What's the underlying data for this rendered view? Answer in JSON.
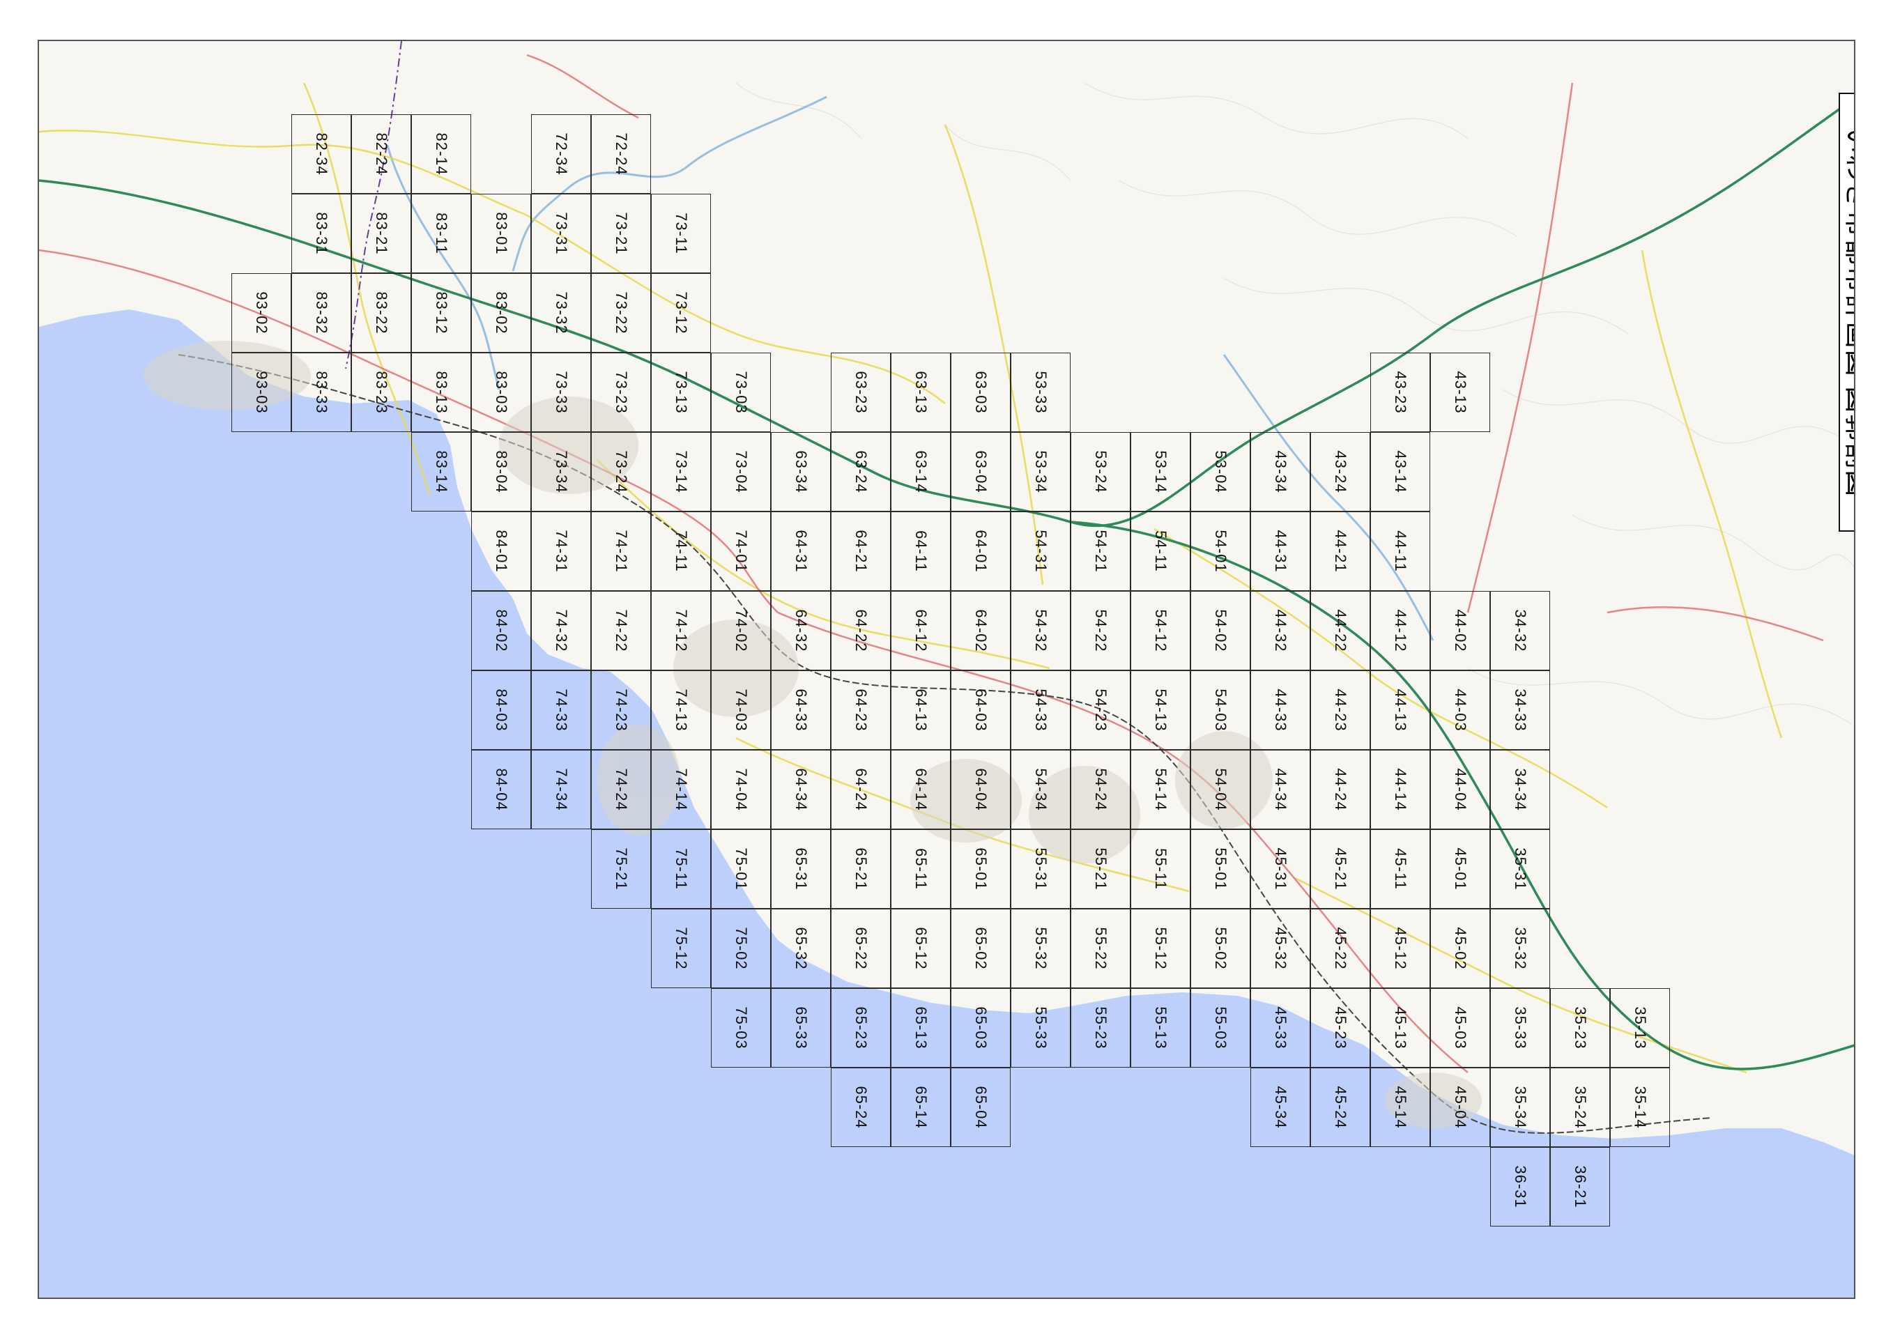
{
  "title": "いわき市都市計画図 図郭割図",
  "colors": {
    "sea": "#bcd0fb",
    "land": "#f7f6f1",
    "expressway": "#2e8b57",
    "national_road": "#e07a7a",
    "prefectural_road": "#e8d84a",
    "railway": "#555555",
    "river": "#6fa8dc",
    "boundary": "#6a3d9a"
  },
  "cells": [
    {
      "id": "82-34",
      "c": 0,
      "r": 0
    },
    {
      "id": "82-24",
      "c": 1,
      "r": 0
    },
    {
      "id": "82-14",
      "c": 2,
      "r": 0
    },
    {
      "id": "72-34",
      "c": 4,
      "r": 0
    },
    {
      "id": "72-24",
      "c": 5,
      "r": 0
    },
    {
      "id": "83-31",
      "c": 0,
      "r": 1
    },
    {
      "id": "83-21",
      "c": 1,
      "r": 1
    },
    {
      "id": "83-11",
      "c": 2,
      "r": 1
    },
    {
      "id": "83-01",
      "c": 3,
      "r": 1
    },
    {
      "id": "73-31",
      "c": 4,
      "r": 1
    },
    {
      "id": "73-21",
      "c": 5,
      "r": 1
    },
    {
      "id": "73-11",
      "c": 6,
      "r": 1
    },
    {
      "id": "93-02",
      "c": -1,
      "r": 2
    },
    {
      "id": "83-32",
      "c": 0,
      "r": 2
    },
    {
      "id": "83-22",
      "c": 1,
      "r": 2
    },
    {
      "id": "83-12",
      "c": 2,
      "r": 2
    },
    {
      "id": "83-02",
      "c": 3,
      "r": 2
    },
    {
      "id": "73-32",
      "c": 4,
      "r": 2
    },
    {
      "id": "73-22",
      "c": 5,
      "r": 2
    },
    {
      "id": "73-12",
      "c": 6,
      "r": 2
    },
    {
      "id": "93-03",
      "c": -1,
      "r": 3
    },
    {
      "id": "83-33",
      "c": 0,
      "r": 3
    },
    {
      "id": "83-23",
      "c": 1,
      "r": 3
    },
    {
      "id": "83-13",
      "c": 2,
      "r": 3
    },
    {
      "id": "83-03",
      "c": 3,
      "r": 3
    },
    {
      "id": "73-33",
      "c": 4,
      "r": 3
    },
    {
      "id": "73-23",
      "c": 5,
      "r": 3
    },
    {
      "id": "73-13",
      "c": 6,
      "r": 3
    },
    {
      "id": "73-03",
      "c": 7,
      "r": 3
    },
    {
      "id": "63-23",
      "c": 9,
      "r": 3
    },
    {
      "id": "63-13",
      "c": 10,
      "r": 3
    },
    {
      "id": "63-03",
      "c": 11,
      "r": 3
    },
    {
      "id": "53-33",
      "c": 12,
      "r": 3
    },
    {
      "id": "43-23",
      "c": 18,
      "r": 3
    },
    {
      "id": "43-13",
      "c": 19,
      "r": 3
    },
    {
      "id": "83-14",
      "c": 2,
      "r": 4
    },
    {
      "id": "83-04",
      "c": 3,
      "r": 4
    },
    {
      "id": "73-34",
      "c": 4,
      "r": 4
    },
    {
      "id": "73-24",
      "c": 5,
      "r": 4
    },
    {
      "id": "73-14",
      "c": 6,
      "r": 4
    },
    {
      "id": "73-04",
      "c": 7,
      "r": 4
    },
    {
      "id": "63-34",
      "c": 8,
      "r": 4
    },
    {
      "id": "63-24",
      "c": 9,
      "r": 4
    },
    {
      "id": "63-14",
      "c": 10,
      "r": 4
    },
    {
      "id": "63-04",
      "c": 11,
      "r": 4
    },
    {
      "id": "53-34",
      "c": 12,
      "r": 4
    },
    {
      "id": "53-24",
      "c": 13,
      "r": 4
    },
    {
      "id": "53-14",
      "c": 14,
      "r": 4
    },
    {
      "id": "53-04",
      "c": 15,
      "r": 4
    },
    {
      "id": "43-34",
      "c": 16,
      "r": 4
    },
    {
      "id": "43-24",
      "c": 17,
      "r": 4
    },
    {
      "id": "43-14",
      "c": 18,
      "r": 4
    },
    {
      "id": "84-01",
      "c": 3,
      "r": 5
    },
    {
      "id": "74-31",
      "c": 4,
      "r": 5
    },
    {
      "id": "74-21",
      "c": 5,
      "r": 5
    },
    {
      "id": "74-11",
      "c": 6,
      "r": 5
    },
    {
      "id": "74-01",
      "c": 7,
      "r": 5
    },
    {
      "id": "64-31",
      "c": 8,
      "r": 5
    },
    {
      "id": "64-21",
      "c": 9,
      "r": 5
    },
    {
      "id": "64-11",
      "c": 10,
      "r": 5
    },
    {
      "id": "64-01",
      "c": 11,
      "r": 5
    },
    {
      "id": "54-31",
      "c": 12,
      "r": 5
    },
    {
      "id": "54-21",
      "c": 13,
      "r": 5
    },
    {
      "id": "54-11",
      "c": 14,
      "r": 5
    },
    {
      "id": "54-01",
      "c": 15,
      "r": 5
    },
    {
      "id": "44-31",
      "c": 16,
      "r": 5
    },
    {
      "id": "44-21",
      "c": 17,
      "r": 5
    },
    {
      "id": "44-11",
      "c": 18,
      "r": 5
    },
    {
      "id": "84-02",
      "c": 3,
      "r": 6
    },
    {
      "id": "74-32",
      "c": 4,
      "r": 6
    },
    {
      "id": "74-22",
      "c": 5,
      "r": 6
    },
    {
      "id": "74-12",
      "c": 6,
      "r": 6
    },
    {
      "id": "74-02",
      "c": 7,
      "r": 6
    },
    {
      "id": "64-32",
      "c": 8,
      "r": 6
    },
    {
      "id": "64-22",
      "c": 9,
      "r": 6
    },
    {
      "id": "64-12",
      "c": 10,
      "r": 6
    },
    {
      "id": "64-02",
      "c": 11,
      "r": 6
    },
    {
      "id": "54-32",
      "c": 12,
      "r": 6
    },
    {
      "id": "54-22",
      "c": 13,
      "r": 6
    },
    {
      "id": "54-12",
      "c": 14,
      "r": 6
    },
    {
      "id": "54-02",
      "c": 15,
      "r": 6
    },
    {
      "id": "44-32",
      "c": 16,
      "r": 6
    },
    {
      "id": "44-22",
      "c": 17,
      "r": 6
    },
    {
      "id": "44-12",
      "c": 18,
      "r": 6
    },
    {
      "id": "44-02",
      "c": 19,
      "r": 6
    },
    {
      "id": "34-32",
      "c": 20,
      "r": 6
    },
    {
      "id": "84-03",
      "c": 3,
      "r": 7
    },
    {
      "id": "74-33",
      "c": 4,
      "r": 7
    },
    {
      "id": "74-23",
      "c": 5,
      "r": 7
    },
    {
      "id": "74-13",
      "c": 6,
      "r": 7
    },
    {
      "id": "74-03",
      "c": 7,
      "r": 7
    },
    {
      "id": "64-33",
      "c": 8,
      "r": 7
    },
    {
      "id": "64-23",
      "c": 9,
      "r": 7
    },
    {
      "id": "64-13",
      "c": 10,
      "r": 7
    },
    {
      "id": "64-03",
      "c": 11,
      "r": 7
    },
    {
      "id": "54-33",
      "c": 12,
      "r": 7
    },
    {
      "id": "54-23",
      "c": 13,
      "r": 7
    },
    {
      "id": "54-13",
      "c": 14,
      "r": 7
    },
    {
      "id": "54-03",
      "c": 15,
      "r": 7
    },
    {
      "id": "44-33",
      "c": 16,
      "r": 7
    },
    {
      "id": "44-23",
      "c": 17,
      "r": 7
    },
    {
      "id": "44-13",
      "c": 18,
      "r": 7
    },
    {
      "id": "44-03",
      "c": 19,
      "r": 7
    },
    {
      "id": "34-33",
      "c": 20,
      "r": 7
    },
    {
      "id": "84-04",
      "c": 3,
      "r": 8
    },
    {
      "id": "74-34",
      "c": 4,
      "r": 8
    },
    {
      "id": "74-24",
      "c": 5,
      "r": 8
    },
    {
      "id": "74-14",
      "c": 6,
      "r": 8
    },
    {
      "id": "74-04",
      "c": 7,
      "r": 8
    },
    {
      "id": "64-34",
      "c": 8,
      "r": 8
    },
    {
      "id": "64-24",
      "c": 9,
      "r": 8
    },
    {
      "id": "64-14",
      "c": 10,
      "r": 8
    },
    {
      "id": "64-04",
      "c": 11,
      "r": 8
    },
    {
      "id": "54-34",
      "c": 12,
      "r": 8
    },
    {
      "id": "54-24",
      "c": 13,
      "r": 8
    },
    {
      "id": "54-14",
      "c": 14,
      "r": 8
    },
    {
      "id": "54-04",
      "c": 15,
      "r": 8
    },
    {
      "id": "44-34",
      "c": 16,
      "r": 8
    },
    {
      "id": "44-24",
      "c": 17,
      "r": 8
    },
    {
      "id": "44-14",
      "c": 18,
      "r": 8
    },
    {
      "id": "44-04",
      "c": 19,
      "r": 8
    },
    {
      "id": "34-34",
      "c": 20,
      "r": 8
    },
    {
      "id": "75-21",
      "c": 5,
      "r": 9
    },
    {
      "id": "75-11",
      "c": 6,
      "r": 9
    },
    {
      "id": "75-01",
      "c": 7,
      "r": 9
    },
    {
      "id": "65-31",
      "c": 8,
      "r": 9
    },
    {
      "id": "65-21",
      "c": 9,
      "r": 9
    },
    {
      "id": "65-11",
      "c": 10,
      "r": 9
    },
    {
      "id": "65-01",
      "c": 11,
      "r": 9
    },
    {
      "id": "55-31",
      "c": 12,
      "r": 9
    },
    {
      "id": "55-21",
      "c": 13,
      "r": 9
    },
    {
      "id": "55-11",
      "c": 14,
      "r": 9
    },
    {
      "id": "55-01",
      "c": 15,
      "r": 9
    },
    {
      "id": "45-31",
      "c": 16,
      "r": 9
    },
    {
      "id": "45-21",
      "c": 17,
      "r": 9
    },
    {
      "id": "45-11",
      "c": 18,
      "r": 9
    },
    {
      "id": "45-01",
      "c": 19,
      "r": 9
    },
    {
      "id": "35-31",
      "c": 20,
      "r": 9
    },
    {
      "id": "75-12",
      "c": 6,
      "r": 10
    },
    {
      "id": "75-02",
      "c": 7,
      "r": 10
    },
    {
      "id": "65-32",
      "c": 8,
      "r": 10
    },
    {
      "id": "65-22",
      "c": 9,
      "r": 10
    },
    {
      "id": "65-12",
      "c": 10,
      "r": 10
    },
    {
      "id": "65-02",
      "c": 11,
      "r": 10
    },
    {
      "id": "55-32",
      "c": 12,
      "r": 10
    },
    {
      "id": "55-22",
      "c": 13,
      "r": 10
    },
    {
      "id": "55-12",
      "c": 14,
      "r": 10
    },
    {
      "id": "55-02",
      "c": 15,
      "r": 10
    },
    {
      "id": "45-32",
      "c": 16,
      "r": 10
    },
    {
      "id": "45-22",
      "c": 17,
      "r": 10
    },
    {
      "id": "45-12",
      "c": 18,
      "r": 10
    },
    {
      "id": "45-02",
      "c": 19,
      "r": 10
    },
    {
      "id": "35-32",
      "c": 20,
      "r": 10
    },
    {
      "id": "75-03",
      "c": 7,
      "r": 11
    },
    {
      "id": "65-33",
      "c": 8,
      "r": 11
    },
    {
      "id": "65-23",
      "c": 9,
      "r": 11
    },
    {
      "id": "65-13",
      "c": 10,
      "r": 11
    },
    {
      "id": "65-03",
      "c": 11,
      "r": 11
    },
    {
      "id": "55-33",
      "c": 12,
      "r": 11
    },
    {
      "id": "55-23",
      "c": 13,
      "r": 11
    },
    {
      "id": "55-13",
      "c": 14,
      "r": 11
    },
    {
      "id": "55-03",
      "c": 15,
      "r": 11
    },
    {
      "id": "45-33",
      "c": 16,
      "r": 11
    },
    {
      "id": "45-23",
      "c": 17,
      "r": 11
    },
    {
      "id": "45-13",
      "c": 18,
      "r": 11
    },
    {
      "id": "45-03",
      "c": 19,
      "r": 11
    },
    {
      "id": "35-33",
      "c": 20,
      "r": 11
    },
    {
      "id": "35-23",
      "c": 21,
      "r": 11
    },
    {
      "id": "35-13",
      "c": 22,
      "r": 11
    },
    {
      "id": "65-24",
      "c": 9,
      "r": 12
    },
    {
      "id": "65-14",
      "c": 10,
      "r": 12
    },
    {
      "id": "65-04",
      "c": 11,
      "r": 12
    },
    {
      "id": "45-34",
      "c": 16,
      "r": 12
    },
    {
      "id": "45-24",
      "c": 17,
      "r": 12
    },
    {
      "id": "45-14",
      "c": 18,
      "r": 12
    },
    {
      "id": "45-04",
      "c": 19,
      "r": 12
    },
    {
      "id": "35-34",
      "c": 20,
      "r": 12
    },
    {
      "id": "35-24",
      "c": 21,
      "r": 12
    },
    {
      "id": "35-14",
      "c": 22,
      "r": 12
    },
    {
      "id": "36-31",
      "c": 20,
      "r": 13
    },
    {
      "id": "36-21",
      "c": 21,
      "r": 13
    }
  ]
}
